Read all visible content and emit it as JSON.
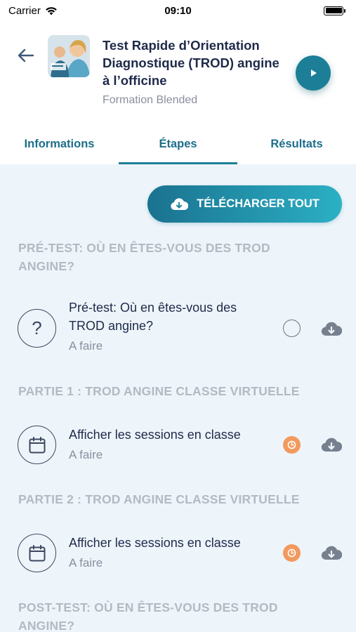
{
  "status_bar": {
    "carrier": "Carrier",
    "time": "09:10"
  },
  "header": {
    "title": "Test Rapide d’Orientation Diagnostique (TROD) angine à l’officine",
    "subtitle": "Formation Blended"
  },
  "tabs": [
    {
      "label": "Informations"
    },
    {
      "label": "Étapes",
      "active": true
    },
    {
      "label": "Résultats"
    }
  ],
  "download_all_label": "TÉLÉCHARGER TOUT",
  "sections": [
    {
      "title": "PRÉ-TEST: OÙ EN ÊTES-VOUS DES TROD ANGINE?",
      "steps": [
        {
          "title": "Pré-test: Où en êtes-vous des TROD angine?",
          "status": "A faire",
          "icon": "question-icon",
          "state_icon": "radio-empty"
        }
      ]
    },
    {
      "title": "PARTIE 1 : TROD ANGINE CLASSE VIRTUELLE",
      "steps": [
        {
          "title": "Afficher les sessions en classe",
          "status": "A faire",
          "icon": "calendar-icon",
          "state_icon": "clock-icon"
        }
      ]
    },
    {
      "title": "PARTIE 2 : TROD ANGINE CLASSE VIRTUELLE",
      "steps": [
        {
          "title": "Afficher les sessions en classe",
          "status": "A faire",
          "icon": "calendar-icon",
          "state_icon": "clock-icon"
        }
      ]
    },
    {
      "title": "POST-TEST: OÙ EN ÊTES-VOUS DES TROD ANGINE?",
      "steps": []
    }
  ],
  "colors": {
    "accent": "#1c7f97",
    "section_title": "#b4b9c4",
    "clock_orange": "#f29a5e",
    "content_bg": "#eef5fa"
  }
}
